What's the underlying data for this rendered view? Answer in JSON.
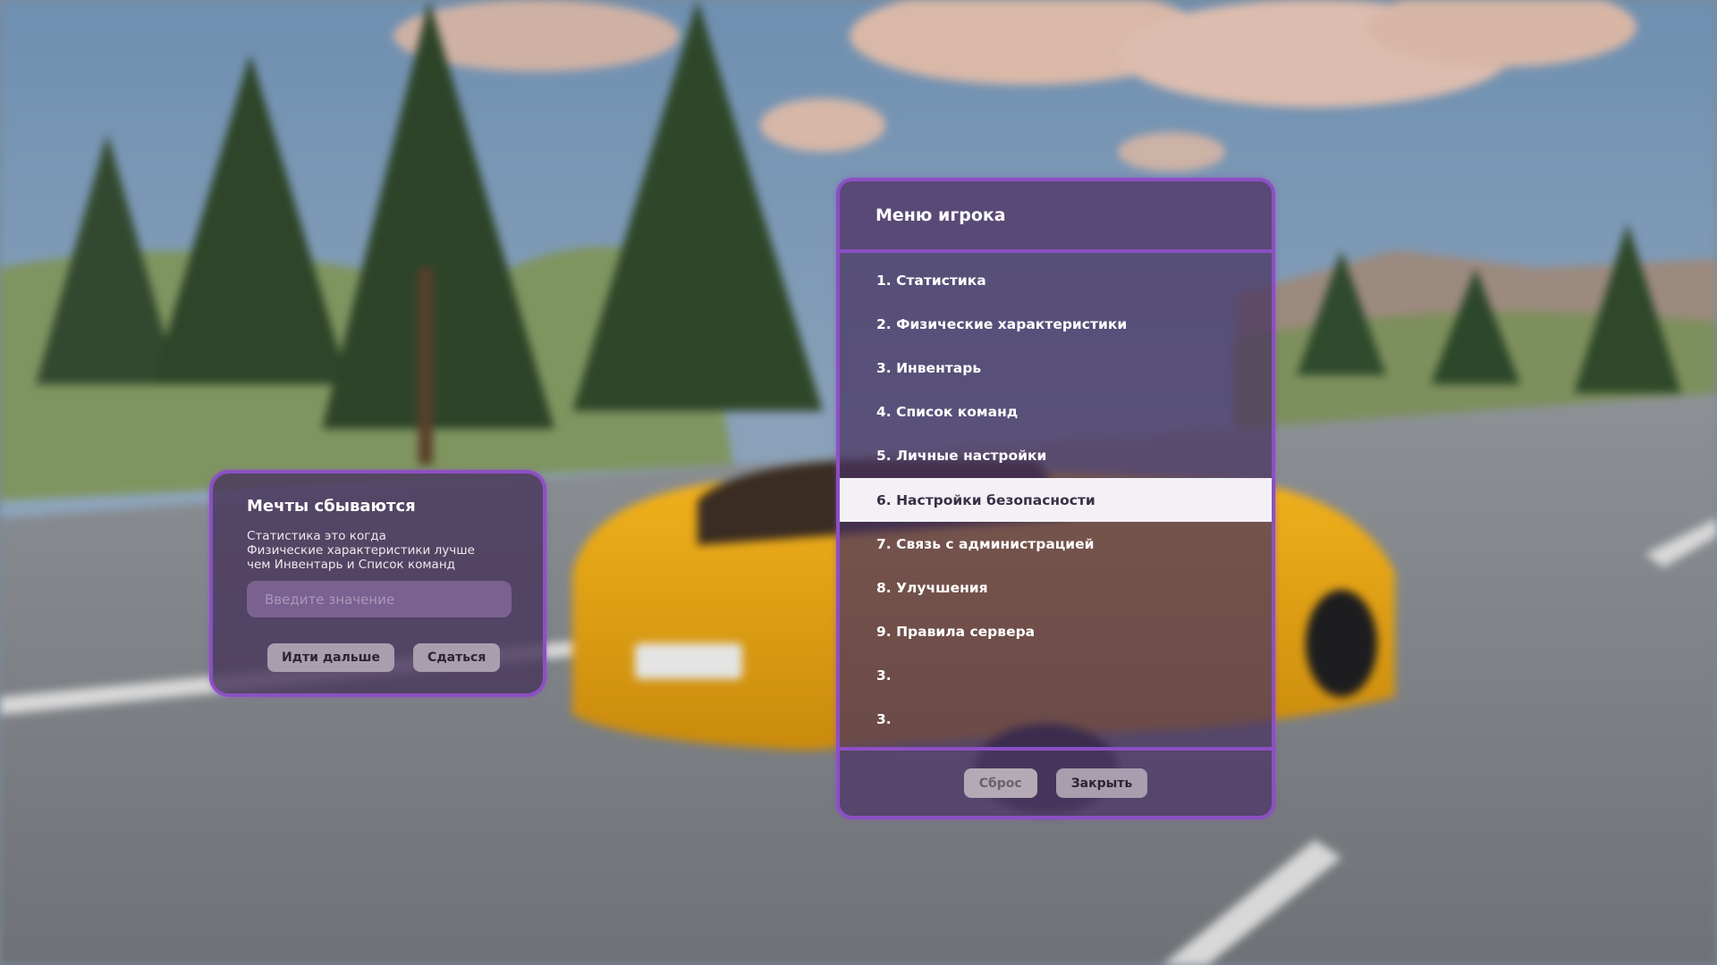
{
  "dialog": {
    "title": "Мечты сбываются",
    "text_lines": [
      "Статистика это когда",
      "Физические характеристики лучше",
      "чем Инвентарь и Список команд"
    ],
    "input": {
      "placeholder": "Введите значение",
      "value": ""
    },
    "buttons": {
      "next": "Идти дальше",
      "give_up": "Сдаться"
    }
  },
  "menu": {
    "title": "Меню игрока",
    "selected_index": 5,
    "items": [
      "1. Статистика",
      "2. Физические характеристики",
      "3. Инвентарь",
      "4. Список команд",
      "5. Личные настройки",
      "6. Настройки безопасности",
      "7. Связь с администрацией",
      "8. Улучшения",
      "9. Правила сервера",
      "3.",
      "3."
    ],
    "buttons": {
      "reset": "Сброс",
      "close": "Закрыть"
    }
  },
  "colors": {
    "accent": "#8c4fc4",
    "panel": "#46325f",
    "selected_row": "#f3f1f6",
    "button": "#a89eae"
  }
}
